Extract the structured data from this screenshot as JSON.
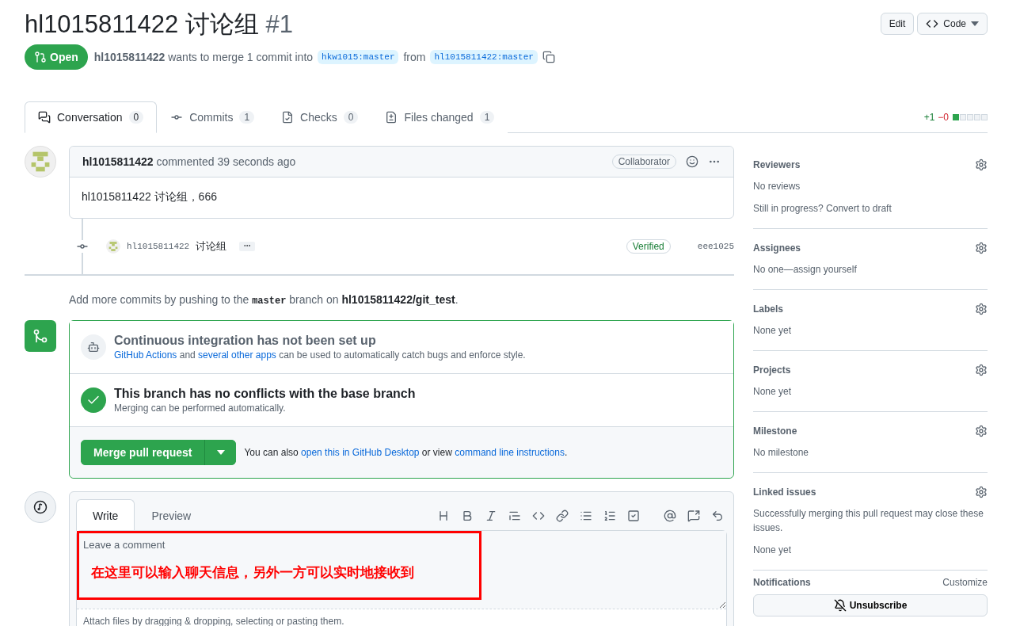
{
  "header": {
    "title": "hl1015811422 讨论组",
    "number": "#1",
    "buttons": [
      {
        "kind": "plain",
        "label": "Edit"
      },
      {
        "kind": "code",
        "label": "Code"
      }
    ]
  },
  "state": {
    "badge": "Open",
    "author": "hl1015811422",
    "text": "wants to merge 1 commit into",
    "base": "hkw1015:master",
    "from": "from",
    "head": "hl1015811422:master"
  },
  "tabs": [
    {
      "kind": "conversation",
      "label": "Conversation",
      "count": "0",
      "selected": true
    },
    {
      "kind": "commits",
      "label": "Commits",
      "count": "1",
      "selected": false
    },
    {
      "kind": "checks",
      "label": "Checks",
      "count": "0",
      "selected": false
    },
    {
      "kind": "files",
      "label": "Files changed",
      "count": "1",
      "selected": false
    }
  ],
  "diffstat": {
    "added": "+1",
    "removed": "−0",
    "blocks": [
      {
        "filled": true
      },
      {
        "filled": false
      },
      {
        "filled": false
      },
      {
        "filled": false
      },
      {
        "filled": false
      }
    ]
  },
  "comment": {
    "author": "hl1015811422",
    "meta": "commented 39 seconds ago",
    "role": "Collaborator",
    "body": "hl1015811422 讨论组，666"
  },
  "commit": {
    "author": "hl1015811422",
    "message": "讨论组",
    "verified": "Verified",
    "sha": "eee1025"
  },
  "push_hint": {
    "before": "Add more commits by pushing to the",
    "branch": "master",
    "middle": "branch on",
    "repo": "hl1015811422/git_test",
    "after": "."
  },
  "merge": {
    "ci_title": "Continuous integration has not been set up",
    "ci_text": [
      {
        "kind": "link",
        "text": "GitHub Actions"
      },
      {
        "kind": "text",
        "text": "and"
      },
      {
        "kind": "link",
        "text": "several other apps"
      },
      {
        "kind": "text",
        "text": "can be used to automatically catch bugs and enforce style."
      }
    ],
    "conflict_title": "This branch has no conflicts with the base branch",
    "conflict_text": "Merging can be performed automatically.",
    "button": "Merge pull request",
    "also": [
      {
        "kind": "text",
        "text": "You can also"
      },
      {
        "kind": "link",
        "text": "open this in GitHub Desktop"
      },
      {
        "kind": "text",
        "text": "or view"
      },
      {
        "kind": "link",
        "text": "command line instructions"
      },
      {
        "kind": "text",
        "text": "."
      }
    ]
  },
  "editor": {
    "tabs": [
      {
        "label": "Write",
        "selected": true
      },
      {
        "label": "Preview",
        "selected": false
      }
    ],
    "placeholder": "Leave a comment",
    "annotation": "在这里可以输入聊天信息，另外一方可以实时地接收到",
    "attach": "Attach files by dragging & dropping, selecting or pasting them."
  },
  "sidebar": [
    {
      "title": "Reviewers",
      "lines": [
        "No reviews",
        "Still in progress? Convert to draft"
      ]
    },
    {
      "title": "Assignees",
      "lines": [
        "No one—assign yourself"
      ]
    },
    {
      "title": "Labels",
      "lines": [
        "None yet"
      ]
    },
    {
      "title": "Projects",
      "lines": [
        "None yet"
      ]
    },
    {
      "title": "Milestone",
      "lines": [
        "No milestone"
      ]
    },
    {
      "title": "Linked issues",
      "lines": [
        "Successfully merging this pull request may close these issues.",
        "None yet"
      ]
    }
  ],
  "notifications": {
    "title": "Notifications",
    "action": "Customize",
    "button": "Unsubscribe"
  }
}
